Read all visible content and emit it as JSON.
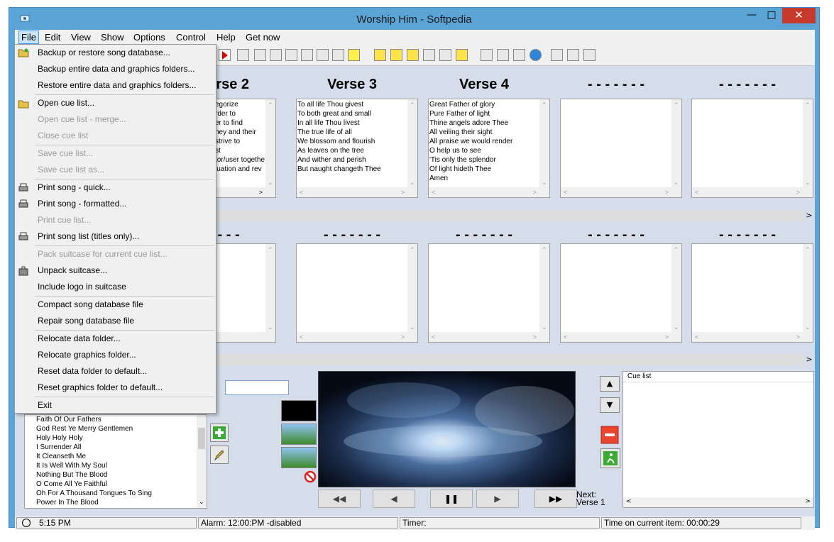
{
  "window": {
    "title": "Worship Him -  Softpedia"
  },
  "menubar": [
    "File",
    "Edit",
    "View",
    "Show",
    "Options",
    "Control",
    "Help",
    "Get now"
  ],
  "file_menu": [
    {
      "label": "Backup or restore song database...",
      "disabled": false,
      "icon": "folder-open-icon"
    },
    {
      "label": "Backup entire data and graphics folders...",
      "disabled": false
    },
    {
      "label": "Restore entire data and graphics folders...",
      "disabled": false
    },
    {
      "label": "Open cue list...",
      "disabled": false,
      "icon": "open-folder-icon"
    },
    {
      "label": "Open cue list - merge...",
      "disabled": true
    },
    {
      "label": "Close cue list",
      "disabled": true
    },
    {
      "label": "Save cue list...",
      "disabled": true
    },
    {
      "label": "Save cue list as...",
      "disabled": true
    },
    {
      "label": "Print song - quick...",
      "disabled": false,
      "icon": "printer-icon"
    },
    {
      "label": "Print song - formatted...",
      "disabled": false,
      "icon": "printer-icon"
    },
    {
      "label": "Print cue list...",
      "disabled": true
    },
    {
      "label": "Print song list (titles only)...",
      "disabled": false,
      "icon": "printer-icon"
    },
    {
      "label": "Pack suitcase for current cue list...",
      "disabled": true
    },
    {
      "label": "Unpack suitcase...",
      "disabled": false,
      "icon": "suitcase-icon"
    },
    {
      "label": "Include logo in suitcase",
      "disabled": false
    },
    {
      "label": "Compact song database file",
      "disabled": false
    },
    {
      "label": "Repair song database file",
      "disabled": false
    },
    {
      "label": "Relocate data folder...",
      "disabled": false
    },
    {
      "label": "Relocate graphics folder...",
      "disabled": false
    },
    {
      "label": "Reset data folder to default...",
      "disabled": false
    },
    {
      "label": "Reset graphics folder to default...",
      "disabled": false
    },
    {
      "label": "Exit",
      "disabled": false
    }
  ],
  "verses_top": [
    {
      "title": "Verse 2",
      "lines": [
        "egorize",
        "rder to",
        "er to find",
        "hey and their",
        "strive to",
        "st",
        "tor/user togethe",
        "luation and rev"
      ]
    },
    {
      "title": "Verse 3",
      "lines": [
        "To all life Thou givest",
        "To both great and small",
        "In all life Thou livest",
        "The true life of all",
        "We blossom and flourish",
        "As leaves on the tree",
        "And wither and perish",
        "But naught changeth Thee"
      ]
    },
    {
      "title": "Verse 4",
      "lines": [
        "Great Father of glory",
        "Pure Father of light",
        "Thine angels adore Thee",
        "All veiling their sight",
        "All praise we would render",
        "O help us to see",
        "'Tis only the splendor",
        "Of light hideth Thee",
        "Amen"
      ]
    },
    {
      "title": "- - - - - - -",
      "lines": []
    },
    {
      "title": "- - - - - - -",
      "lines": []
    }
  ],
  "verses_bottom": [
    "- - - -",
    "- - - - - - -",
    "- - - - - - -",
    "- - - - - - -",
    "- - - - - - -"
  ],
  "song_list": [
    "Faith Of Our Fathers",
    "God Rest Ye Merry Gentlemen",
    "Holy Holy Holy",
    "I Surrender All",
    "It Cleanseth Me",
    "It Is Well With My Soul",
    "Nothing But The Blood",
    "O Come All Ye Faithful",
    "Oh For A Thousand Tongues To Sing",
    "Power In The Blood"
  ],
  "playback": {
    "rewind": "◀◀",
    "prev": "◀",
    "pause": "❚❚",
    "next": "▶",
    "forward": "▶▶"
  },
  "next_label": "Next:",
  "next_value": "Verse 1",
  "cue_list": {
    "header": "Cue list"
  },
  "status": {
    "time": "5:15 PM",
    "alarm": "Alarm: 12:00:PM -disabled",
    "timer": "Timer:",
    "current": "Time on current item: 00:00:29"
  },
  "colors": {
    "titlebar": "#5ba4d6",
    "client": "#d4dde9",
    "close": "#c7392b",
    "menu_highlight": "#cce4f7"
  }
}
